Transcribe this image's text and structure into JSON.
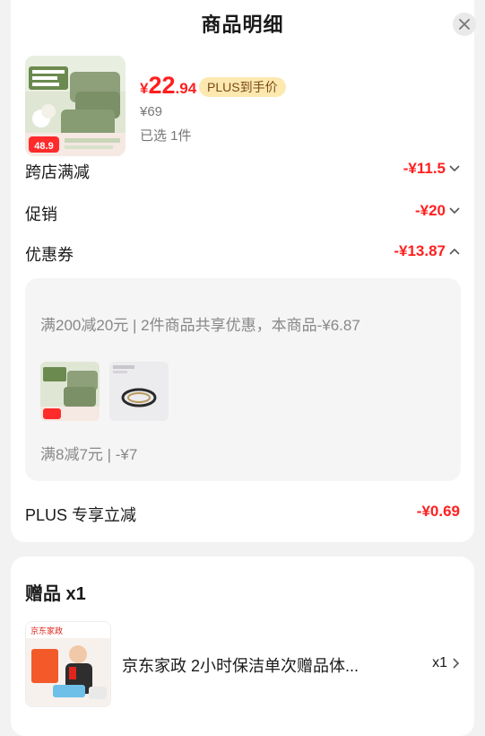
{
  "header": {
    "title": "商品明细"
  },
  "product": {
    "currency": "¥",
    "price_int": "22",
    "price_dec": ".94",
    "plus_tag": "PLUS到手价",
    "original_price": "¥69",
    "selected": "已选 1件",
    "image_badge": "48.9"
  },
  "discounts": {
    "cross_store": {
      "label": "跨店满减",
      "value": "-¥11.5"
    },
    "promotion": {
      "label": "促销",
      "value": "-¥20"
    },
    "coupon": {
      "label": "优惠券",
      "value": "-¥13.87"
    }
  },
  "coupon_details": {
    "line1": "满200减20元 | 2件商品共享优惠，本商品-¥6.87",
    "line2": "满8减7元 | -¥7"
  },
  "plus_discount": {
    "label": "PLUS 专享立减",
    "value": "-¥0.69"
  },
  "gift": {
    "title": "赠品 x1",
    "name": "京东家政 2小时保洁单次赠品体...",
    "qty": "x1",
    "brand": "京东家政"
  },
  "colors": {
    "accent_red": "#ff1f1f",
    "plus_bg": "#fde8b0",
    "plus_text": "#7a4a12"
  }
}
